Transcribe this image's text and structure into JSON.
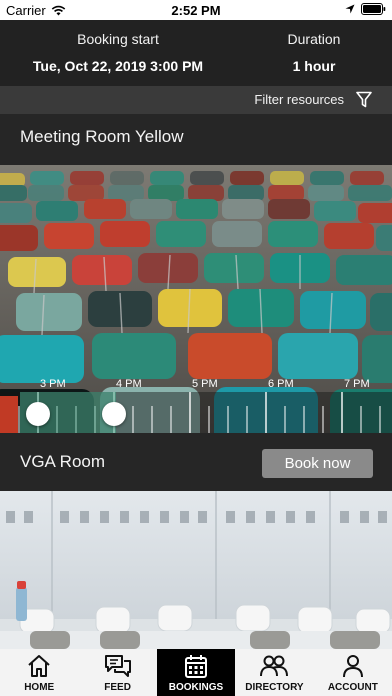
{
  "status_bar": {
    "carrier": "Carrier",
    "time": "2:52 PM"
  },
  "booking_header": {
    "start_label": "Booking start",
    "start_value": "Tue, Oct 22, 2019 3:00 PM",
    "duration_label": "Duration",
    "duration_value": "1 hour"
  },
  "filter": {
    "label": "Filter resources"
  },
  "rooms": [
    {
      "name": "Meeting Room Yellow",
      "timeline": {
        "labels": [
          "3 PM",
          "4 PM",
          "5 PM",
          "6 PM",
          "7 PM"
        ],
        "selection_start": "3:00 PM",
        "selection_end": "4:00 PM"
      }
    },
    {
      "name": "VGA Room",
      "action_label": "Book now"
    }
  ],
  "tab_bar": {
    "items": [
      {
        "label": "HOME",
        "icon": "home-icon",
        "active": false
      },
      {
        "label": "FEED",
        "icon": "chat-icon",
        "active": false
      },
      {
        "label": "BOOKINGS",
        "icon": "calendar-icon",
        "active": true
      },
      {
        "label": "DIRECTORY",
        "icon": "people-icon",
        "active": false
      },
      {
        "label": "ACCOUNT",
        "icon": "user-icon",
        "active": false
      }
    ]
  },
  "colors": {
    "dark_bg": "#222222",
    "booked": "#c13a25",
    "selection": "#4aaa8c",
    "button": "#8a8a8a"
  }
}
